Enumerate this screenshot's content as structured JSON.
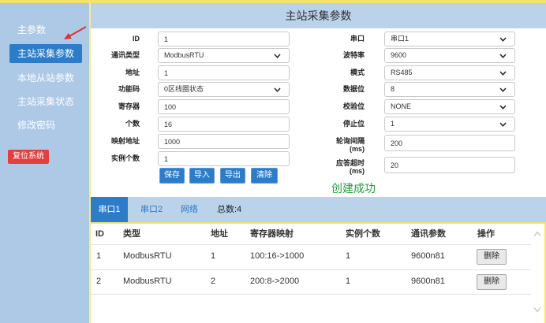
{
  "header": {
    "title": "主站采集参数"
  },
  "sidebar": {
    "items": [
      {
        "label": "主参数",
        "active": false
      },
      {
        "label": "主站采集参数",
        "active": true
      },
      {
        "label": "本地从站参数",
        "active": false
      },
      {
        "label": "主站采集状态",
        "active": false
      },
      {
        "label": "修改密码",
        "active": false
      }
    ],
    "reset_button": "复位系统"
  },
  "form": {
    "left": [
      {
        "label": "ID",
        "value": "1"
      },
      {
        "label": "通讯类型",
        "value": "ModbusRTU"
      },
      {
        "label": "地址",
        "value": "1"
      },
      {
        "label": "功能码",
        "value": "0区线圈状态"
      },
      {
        "label": "寄存器",
        "value": "100"
      },
      {
        "label": "个数",
        "value": "16"
      },
      {
        "label": "映射地址",
        "value": "1000"
      },
      {
        "label": "实例个数",
        "value": "1"
      }
    ],
    "right": [
      {
        "label": "串口",
        "value": "串口1"
      },
      {
        "label": "波特率",
        "value": "9600"
      },
      {
        "label": "模式",
        "value": "RS485"
      },
      {
        "label": "数据位",
        "value": "8"
      },
      {
        "label": "校验位",
        "value": "NONE"
      },
      {
        "label": "停止位",
        "value": "1"
      },
      {
        "label": "轮询间隔",
        "unit": "(ms)",
        "value": "200"
      },
      {
        "label": "应答超时",
        "unit": "(ms)",
        "value": "20"
      }
    ],
    "buttons": {
      "save": "保存",
      "import": "导入",
      "export": "导出",
      "clear": "清除"
    },
    "status_message": "创建成功"
  },
  "tabs": {
    "items": [
      {
        "label": "串口1",
        "active": true
      },
      {
        "label": "串口2",
        "active": false
      },
      {
        "label": "网络",
        "active": false
      }
    ],
    "total": "总数:4"
  },
  "table": {
    "columns": [
      "ID",
      "类型",
      "地址",
      "寄存器映射",
      "实例个数",
      "通讯参数",
      "操作"
    ],
    "rows": [
      {
        "id": "1",
        "type": "ModbusRTU",
        "address": "1",
        "register_map": "100:16->1000",
        "instances": "1",
        "comm_params": "9600n81",
        "action": "删除"
      },
      {
        "id": "2",
        "type": "ModbusRTU",
        "address": "2",
        "register_map": "200:8->2000",
        "instances": "1",
        "comm_params": "9600n81",
        "action": "删除"
      }
    ]
  },
  "icons": {
    "select_arrow": "chevron-down-icon",
    "scroll_up": "chevron-up-icon",
    "scroll_down": "chevron-down-icon",
    "annotation": "red-arrow-icon"
  },
  "colors": {
    "sidebar_bg": "#aec9e6",
    "header_bg": "#bad2ea",
    "accent": "#2d7cca",
    "danger": "#e2403e",
    "success": "#22a03a",
    "frame_yellow": "#f3e26c",
    "annotation_red": "#e0302c"
  }
}
